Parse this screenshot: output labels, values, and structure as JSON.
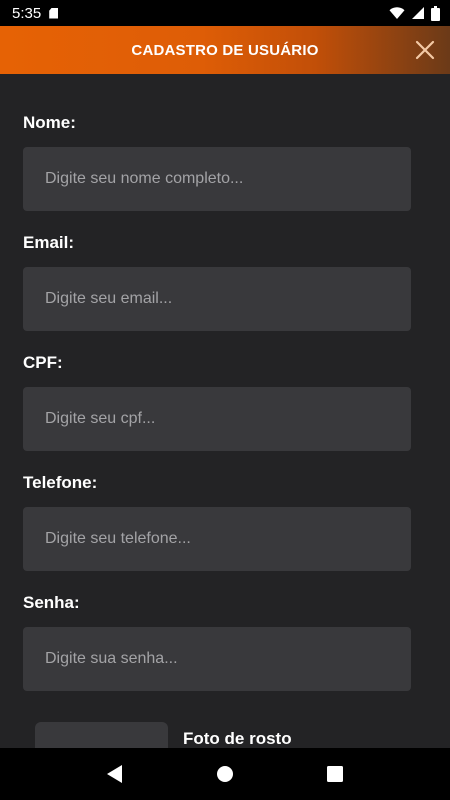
{
  "status_bar": {
    "time": "5:35",
    "icons": [
      "sd-card-icon",
      "wifi-icon",
      "signal-icon",
      "battery-icon"
    ]
  },
  "header": {
    "title": "CADASTRO DE USUÁRIO",
    "close_icon": "close-icon"
  },
  "form": {
    "fields": [
      {
        "label": "Nome:",
        "placeholder": "Digite seu nome completo...",
        "value": ""
      },
      {
        "label": "Email:",
        "placeholder": "Digite seu email...",
        "value": ""
      },
      {
        "label": "CPF:",
        "placeholder": "Digite seu cpf...",
        "value": ""
      },
      {
        "label": "Telefone:",
        "placeholder": "Digite seu telefone...",
        "value": ""
      },
      {
        "label": "Senha:",
        "placeholder": "Digite sua senha...",
        "value": ""
      }
    ],
    "photo_label": "Foto de rosto"
  },
  "nav_bar": {
    "icons": [
      "back-icon",
      "home-icon",
      "recents-icon"
    ]
  },
  "colors": {
    "background": "#232325",
    "input_bg": "#39393c",
    "accent": "#e66205"
  }
}
